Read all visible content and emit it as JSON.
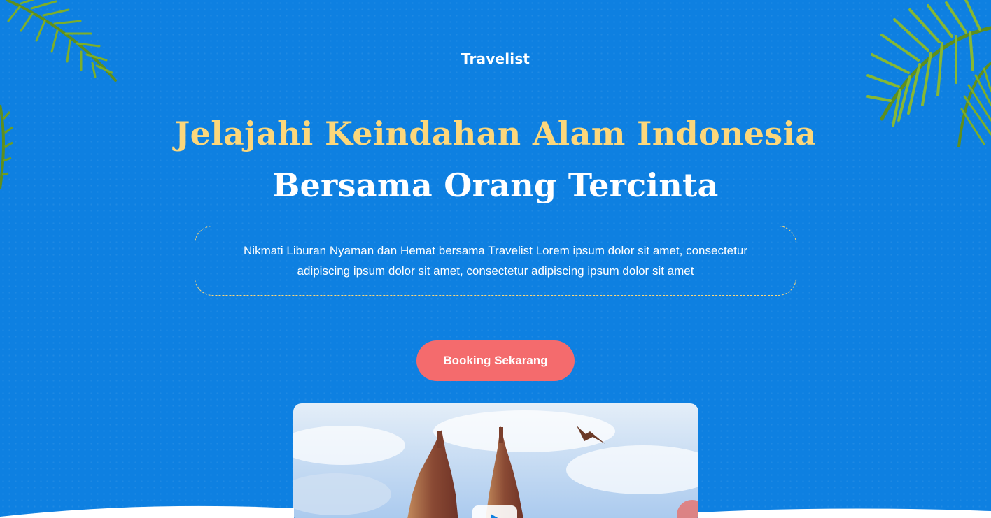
{
  "brand": {
    "name": "Travelist"
  },
  "hero": {
    "headline_line1": "Jelajahi Keindahan Alam Indonesia",
    "headline_line2": "Bersama Orang Tercinta",
    "description": "Nikmati Liburan Nyaman dan Hemat bersama Travelist  Lorem ipsum dolor sit amet, consectetur adipiscing ipsum dolor sit amet, consectetur adipiscing ipsum dolor sit amet",
    "cta_label": "Booking Sekarang"
  },
  "colors": {
    "background": "#0e80e1",
    "headline_accent": "#fcd77b",
    "cta": "#f46b6d",
    "text": "#ffffff"
  },
  "icons": {
    "palm_left": "palm-leaf-icon",
    "palm_right": "palm-leaf-icon",
    "bird": "bird-icon",
    "play": "play-icon"
  }
}
